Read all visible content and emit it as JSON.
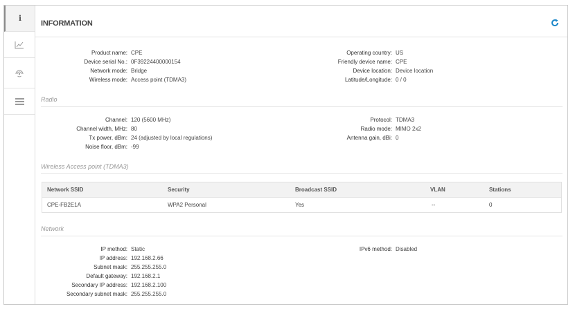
{
  "page": {
    "title": "INFORMATION"
  },
  "sidebar": {
    "items": [
      {
        "icon": "info-icon",
        "glyph": "i"
      },
      {
        "icon": "chart-icon"
      },
      {
        "icon": "wireless-icon"
      },
      {
        "icon": "list-icon"
      }
    ]
  },
  "info": {
    "left": [
      {
        "label": "Product name:",
        "value": "CPE"
      },
      {
        "label": "Device serial No.:",
        "value": "0F39224400000154"
      },
      {
        "label": "Network mode:",
        "value": "Bridge"
      },
      {
        "label": "Wireless mode:",
        "value": "Access point (TDMA3)"
      }
    ],
    "right": [
      {
        "label": "Operating country:",
        "value": "US"
      },
      {
        "label": "Friendly device name:",
        "value": "CPE"
      },
      {
        "label": "Device location:",
        "value": "Device location"
      },
      {
        "label": "Latitude/Longitude:",
        "value": "0 / 0"
      }
    ]
  },
  "radio": {
    "title": "Radio",
    "left": [
      {
        "label": "Channel:",
        "value": "120 (5600 MHz)"
      },
      {
        "label": "Channel width, MHz:",
        "value": "80"
      },
      {
        "label": "Tx power, dBm:",
        "value": "24 (adjusted by local regulations)"
      },
      {
        "label": "Noise floor, dBm:",
        "value": "-99"
      }
    ],
    "right": [
      {
        "label": "Protocol:",
        "value": "TDMA3"
      },
      {
        "label": "Radio mode:",
        "value": "MIMO 2x2"
      },
      {
        "label": "Antenna gain, dBi:",
        "value": "0"
      }
    ]
  },
  "wap": {
    "title": "Wireless Access point (TDMA3)",
    "columns": [
      "Network SSID",
      "Security",
      "Broadcast SSID",
      "VLAN",
      "Stations"
    ],
    "rows": [
      [
        "CPE-FB2E1A",
        "WPA2 Personal",
        "Yes",
        "--",
        "0"
      ]
    ]
  },
  "network": {
    "title": "Network",
    "left": [
      {
        "label": "IP method:",
        "value": "Static"
      },
      {
        "label": "IP address:",
        "value": "192.168.2.66"
      },
      {
        "label": "Subnet mask:",
        "value": "255.255.255.0"
      },
      {
        "label": "Default gateway:",
        "value": "192.168.2.1"
      },
      {
        "label": "Secondary IP address:",
        "value": "192.168.2.100"
      },
      {
        "label": "Secondary subnet mask:",
        "value": "255.255.255.0"
      }
    ],
    "right": [
      {
        "label": "IPv6 method:",
        "value": "Disabled"
      }
    ]
  },
  "colors": {
    "accent": "#1e88c9"
  }
}
